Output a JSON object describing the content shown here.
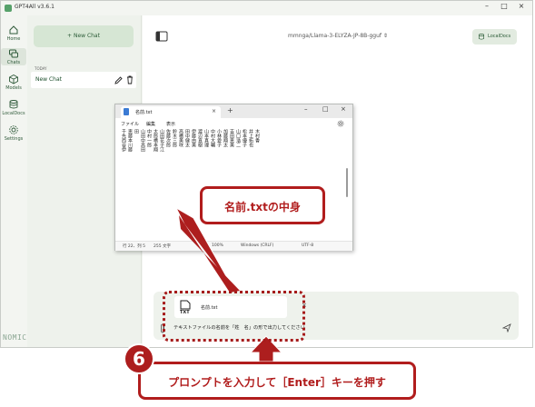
{
  "app": {
    "title": "GPT4All v3.6.1"
  },
  "rail": {
    "items": [
      {
        "label": "Home",
        "icon": "home-icon"
      },
      {
        "label": "Chats",
        "icon": "chats-icon"
      },
      {
        "label": "Models",
        "icon": "models-icon"
      },
      {
        "label": "LocalDocs",
        "icon": "localdocs-icon"
      },
      {
        "label": "Settings",
        "icon": "settings-icon"
      }
    ],
    "brand": "NOMIC"
  },
  "chatlist": {
    "new_chat_label": "+ New Chat",
    "section_label": "TODAY",
    "items": [
      {
        "label": "New Chat"
      }
    ]
  },
  "main": {
    "model": "mmnga/Llama-3-ELYZA-JP-8B-gguf",
    "localdocs_label": "LocalDocs"
  },
  "prompt": {
    "attachment_name": "名前.txt",
    "attachment_type": "TXT",
    "text": "テキストファイルの名前を「姓　名」の形で出力してください"
  },
  "notepad": {
    "tab_title": "名前.txt",
    "menu": [
      "ファイル",
      "編集",
      "表示"
    ],
    "lines": [
      "千先西谷伊",
      "恵藤本川藤",
      "田",
      "山田中高田",
      "中村一郎",
      "太郎橋本翔",
      "山田花子江",
      "佐藤次郎",
      "鈴木三郎",
      "高橋美咲",
      "田中健太",
      "伊藤由美",
      "渡辺直樹",
      "山本真理",
      "中村大輔",
      "小林愛子",
      "加藤翔太",
      "吉田恵美",
      "山口浩二",
      "松本優子",
      "井上拓也",
      "木村香"
    ],
    "status": {
      "position": "行 22、列 5",
      "chars": "255 文字",
      "zoom": "100%",
      "eol": "Windows (CRLF)",
      "encoding": "UTF-8"
    }
  },
  "annotations": {
    "callout": "名前.txtの中身",
    "step_number": "6",
    "step_text": "プロンプトを入力して［Enter］キーを押す",
    "color": "#b11d1d"
  }
}
